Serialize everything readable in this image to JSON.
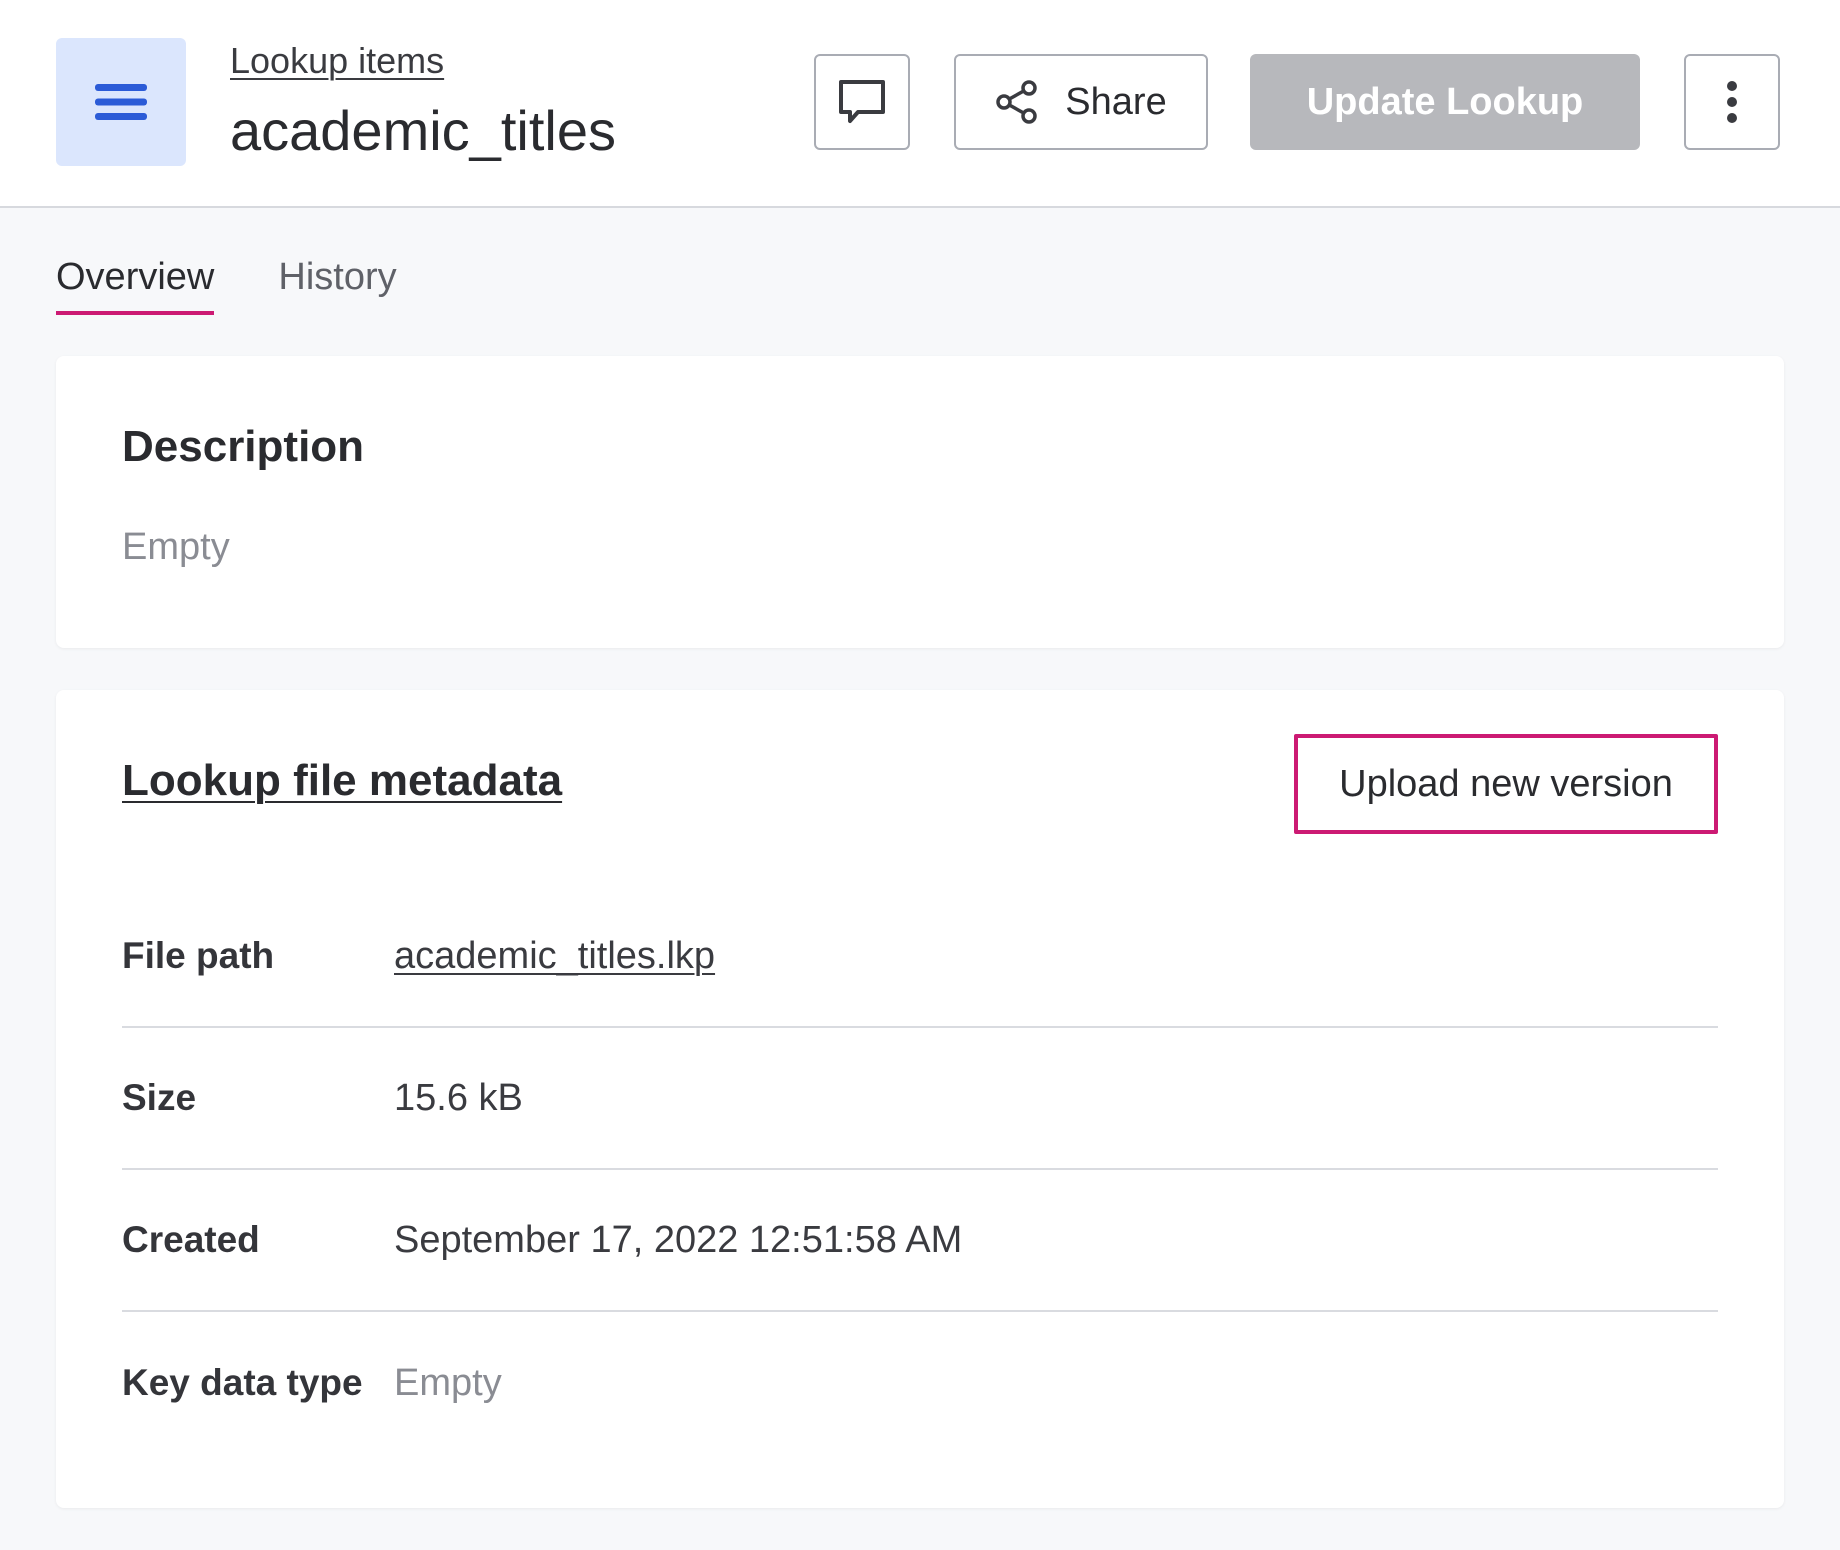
{
  "header": {
    "breadcrumb": "Lookup items",
    "title": "academic_titles",
    "share_label": "Share",
    "update_label": "Update Lookup",
    "icons": {
      "menu": "hamburger-icon",
      "comment": "comment-icon",
      "share": "share-icon",
      "more": "vertical-dots-icon"
    }
  },
  "tabs": [
    {
      "label": "Overview",
      "active": true
    },
    {
      "label": "History",
      "active": false
    }
  ],
  "description": {
    "heading": "Description",
    "value": "Empty"
  },
  "metadata": {
    "heading": "Lookup file metadata",
    "upload_label": "Upload new version",
    "rows": [
      {
        "label": "File path",
        "value": "academic_titles.lkp"
      },
      {
        "label": "Size",
        "value": "15.6 kB"
      },
      {
        "label": "Created",
        "value": "September 17, 2022 12:51:58 AM"
      },
      {
        "label": "Key data type",
        "value": "Empty"
      }
    ]
  },
  "colors": {
    "accent": "#cc1a73",
    "menu_bg": "#dbe6fd",
    "menu_icon": "#2b5bd7",
    "disabled_button": "#b7b8bc"
  }
}
